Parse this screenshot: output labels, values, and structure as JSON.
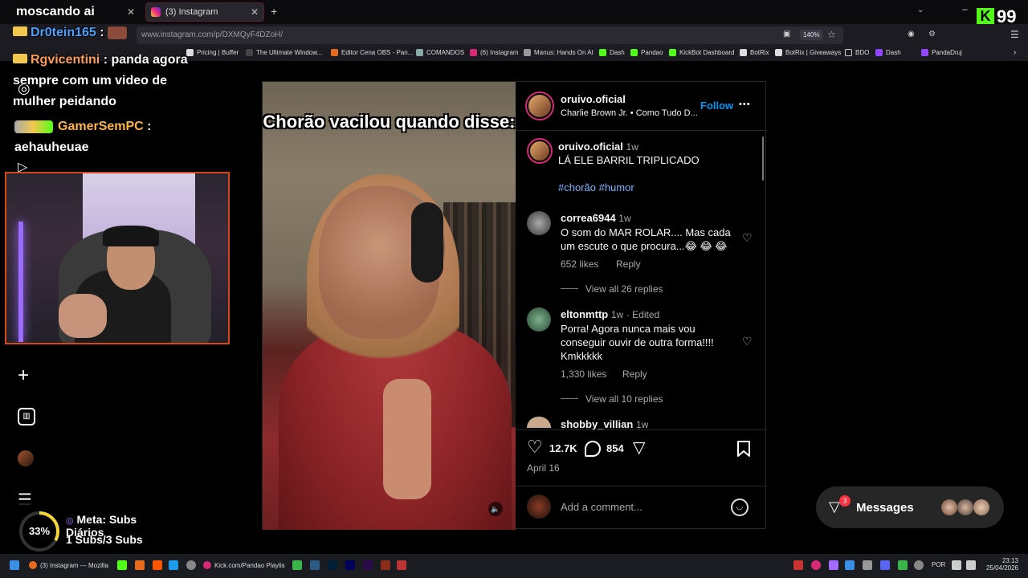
{
  "browser": {
    "tabs": [
      {
        "label": "moscando ai"
      },
      {
        "label": "(3) Instagram"
      }
    ],
    "url": "www.instagram.com/p/DXMQyF4DZoH/",
    "zoom": "140%",
    "bookmarks": [
      "Pricing | Buffer",
      "The Ultimate Window...",
      "Editor Cena OBS - Pan...",
      "COMANDOS",
      "(6) Instagram",
      "Manus: Hands On AI",
      "Dash",
      "Pandao",
      "KickBot Dashboard",
      "BotRix",
      "BotRix | Giveaways",
      "BDO",
      "Dash",
      "PandaDruj"
    ]
  },
  "overlay": {
    "brand": "99",
    "chat": [
      {
        "user": "Dr0tein165",
        "sep": ":",
        "msg": ""
      },
      {
        "user": "Rgvicentini",
        "sep": ":",
        "msg": "panda agora sempre com um video de mulher peidando"
      },
      {
        "user": "GamerSemPC",
        "sep": ":",
        "msg": "aehauheuae"
      }
    ],
    "goal": {
      "percent": "33%",
      "title": "Meta: Subs Diários",
      "progress": "1 Subs/3 Subs",
      "fraction": 0.33
    }
  },
  "post": {
    "video_caption": "Chorão vacilou quando disse:",
    "author": "oruivo.oficial",
    "audio": "Charlie Brown Jr. • Como Tudo D...",
    "follow": "Follow",
    "more": "•••",
    "caption": {
      "user": "oruivo.oficial",
      "time": "1w",
      "text": "LÁ ELE BARRIL TRIPLICADO",
      "tags": "#chorão #humor"
    },
    "comments": [
      {
        "user": "correa6944",
        "time": "1w",
        "edited": "",
        "text": "O som do MAR ROLAR.... Mas cada um escute o que procura...😂 😂 😂",
        "likes": "652 likes",
        "reply": "Reply",
        "view": "View all 26 replies"
      },
      {
        "user": "eltonmttp",
        "time": "1w",
        "edited": "· Edited",
        "text": "Porra! Agora nunca mais vou conseguir ouvir de outra forma!!!! Kmkkkkk",
        "likes": "1,330 likes",
        "reply": "Reply",
        "view": "View all 10 replies"
      },
      {
        "user": "shobby_villian",
        "time": "1w",
        "edited": "",
        "text": "",
        "likes": "",
        "reply": "",
        "view": ""
      }
    ],
    "like_count": "12.7K",
    "comment_count": "854",
    "date": "April 16",
    "add_comment_placeholder": "Add a comment..."
  },
  "messages": {
    "label": "Messages",
    "badge": "3"
  },
  "taskbar": {
    "window1": "(3) Instagram — Mozilla",
    "window2": "Kick.com/Pandao Playlis",
    "lang": "POR",
    "time": "23:13",
    "date": "25/04/2026"
  }
}
